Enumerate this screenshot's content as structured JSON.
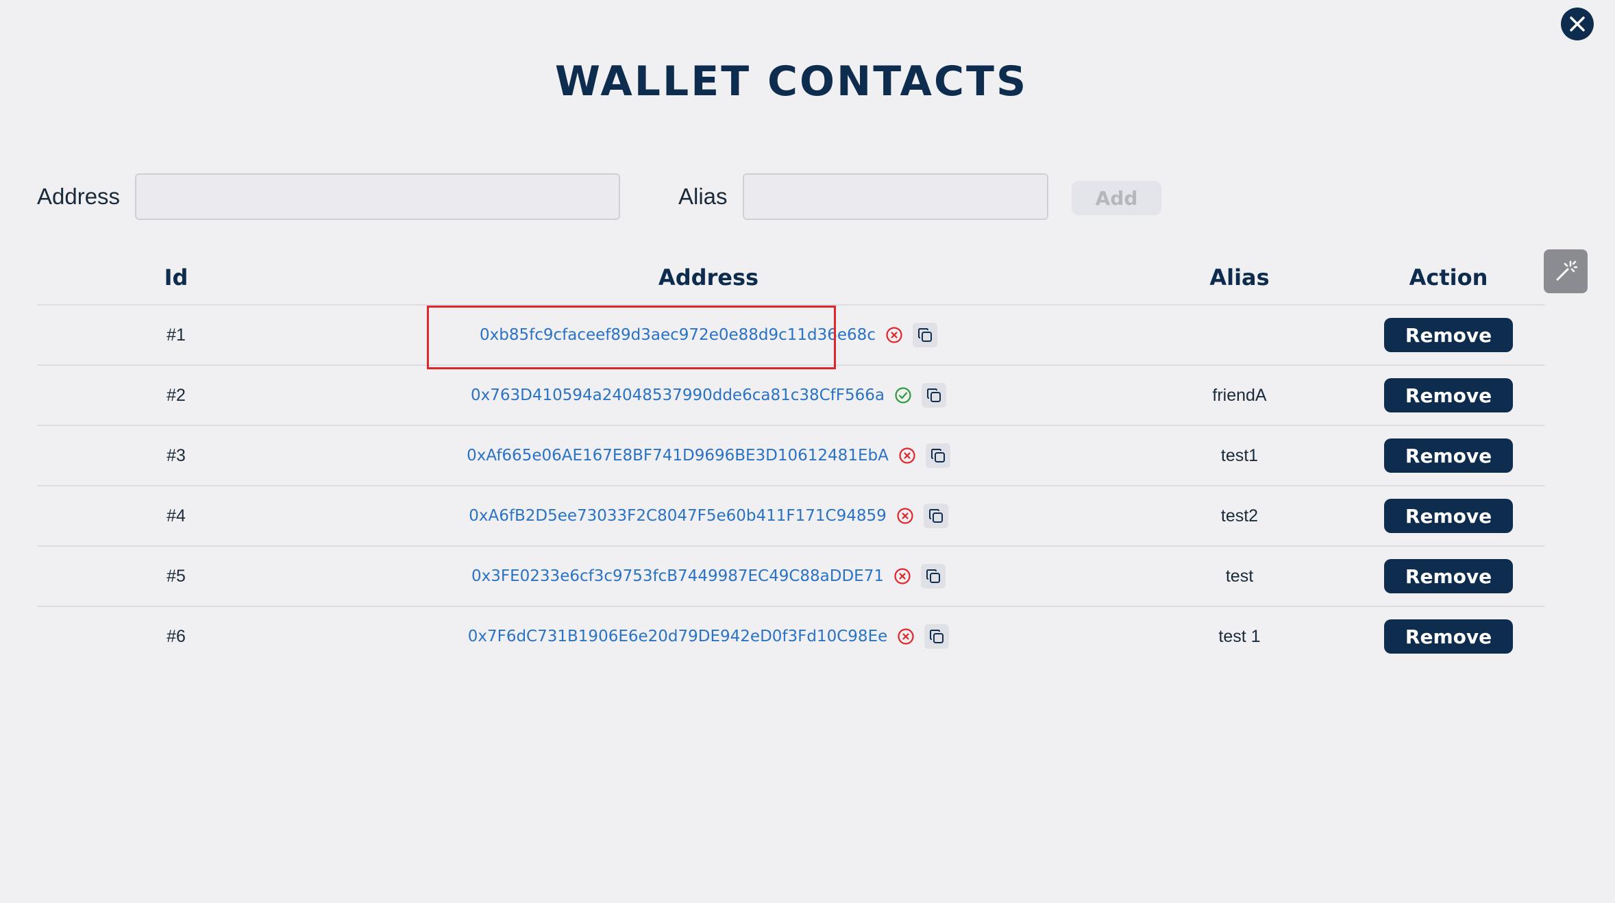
{
  "title": "WALLET CONTACTS",
  "form": {
    "address_label": "Address",
    "address_value": "",
    "alias_label": "Alias",
    "alias_value": "",
    "add_label": "Add"
  },
  "table": {
    "headers": {
      "id": "Id",
      "address": "Address",
      "alias": "Alias",
      "action": "Action"
    },
    "rows": [
      {
        "id": "#1",
        "address": "0xb85fc9cfaceef89d3aec972e0e88d9c11d36e68c",
        "status": "invalid",
        "alias": "",
        "action": "Remove"
      },
      {
        "id": "#2",
        "address": "0x763D410594a24048537990dde6ca81c38CfF566a",
        "status": "valid",
        "alias": "friendA",
        "action": "Remove"
      },
      {
        "id": "#3",
        "address": "0xAf665e06AE167E8BF741D9696BE3D10612481EbA",
        "status": "invalid",
        "alias": "test1",
        "action": "Remove"
      },
      {
        "id": "#4",
        "address": "0xA6fB2D5ee73033F2C8047F5e60b411F171C94859",
        "status": "invalid",
        "alias": "test2",
        "action": "Remove"
      },
      {
        "id": "#5",
        "address": "0x3FE0233e6cf3c9753fcB7449987EC49C88aDDE71",
        "status": "invalid",
        "alias": "test",
        "action": "Remove"
      },
      {
        "id": "#6",
        "address": "0x7F6dC731B1906E6e20d79DE942eD0f3Fd10C98Ee",
        "status": "invalid",
        "alias": "test 1",
        "action": "Remove"
      }
    ]
  },
  "icons": {
    "close": "close-icon",
    "wand": "magic-wand-icon",
    "valid": "check-circle-icon",
    "invalid": "x-circle-icon",
    "copy": "copy-icon"
  },
  "colors": {
    "primary": "#0d2c4e",
    "link": "#2a72c4",
    "valid": "#2e9a3c",
    "invalid": "#e0262b",
    "highlight": "#e0262b"
  }
}
